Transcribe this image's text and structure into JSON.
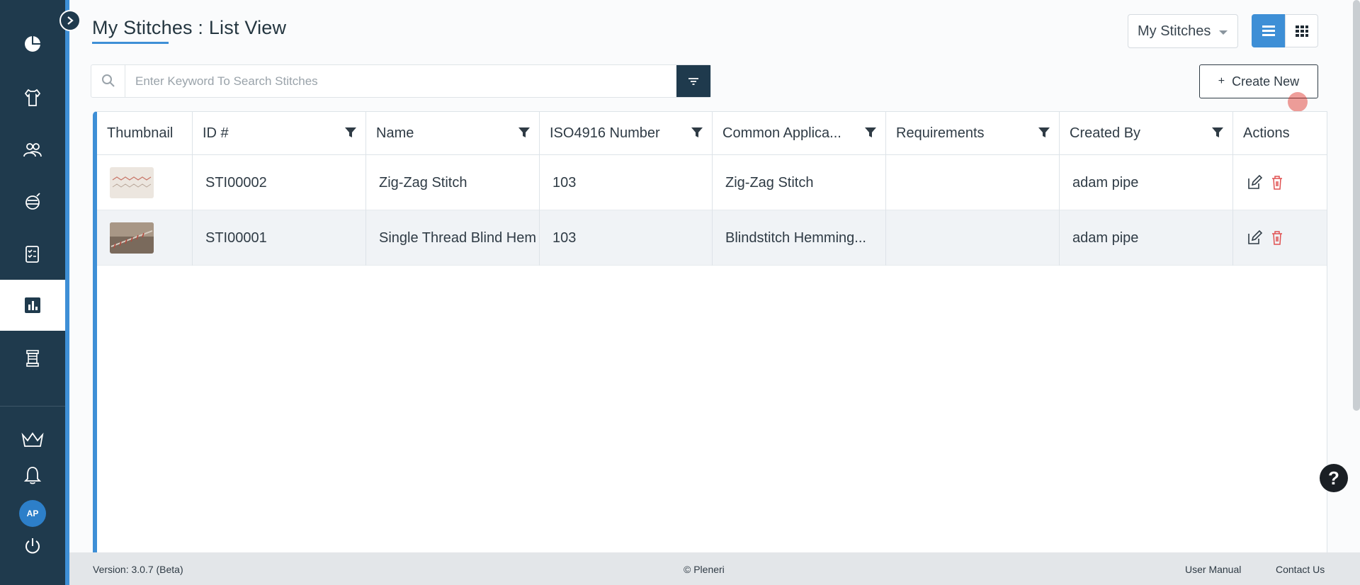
{
  "page": {
    "title": "My Stitches : List View",
    "scope_dropdown": "My Stitches",
    "search_placeholder": "Enter Keyword To Search Stitches",
    "create_button": "Create New",
    "create_icon": "+"
  },
  "sidebar": {
    "items": [
      {
        "name": "dashboard",
        "icon": "pie-chart-icon"
      },
      {
        "name": "apparel",
        "icon": "shirt-icon"
      },
      {
        "name": "team",
        "icon": "users-icon"
      },
      {
        "name": "materials",
        "icon": "thread-icon"
      },
      {
        "name": "specs",
        "icon": "checklist-icon"
      },
      {
        "name": "reports",
        "icon": "bar-chart-icon",
        "active": true
      },
      {
        "name": "library",
        "icon": "spool-icon"
      }
    ],
    "bottom": [
      "crown-icon",
      "bell-icon",
      "avatar",
      "power-icon"
    ],
    "avatar_initials": "AP"
  },
  "table": {
    "columns": [
      "Thumbnail",
      "ID #",
      "Name",
      "ISO4916 Number",
      "Common Applica...",
      "Requirements",
      "Created By",
      "Actions"
    ],
    "rows": [
      {
        "id": "STI00002",
        "name": "Zig-Zag Stitch",
        "iso": "103",
        "application": "Zig-Zag Stitch",
        "requirements": "",
        "created_by": "adam pipe"
      },
      {
        "id": "STI00001",
        "name": "Single Thread Blind Hem",
        "iso": "103",
        "application": "Blindstitch Hemming...",
        "requirements": "",
        "created_by": "adam pipe"
      }
    ]
  },
  "footer": {
    "version": "Version: 3.0.7 (Beta)",
    "copyright": "© Pleneri",
    "user_manual": "User Manual",
    "contact": "Contact Us"
  },
  "colors": {
    "sidebar": "#1f3a4d",
    "accent": "#3e8fd6",
    "delete": "#e05050"
  }
}
